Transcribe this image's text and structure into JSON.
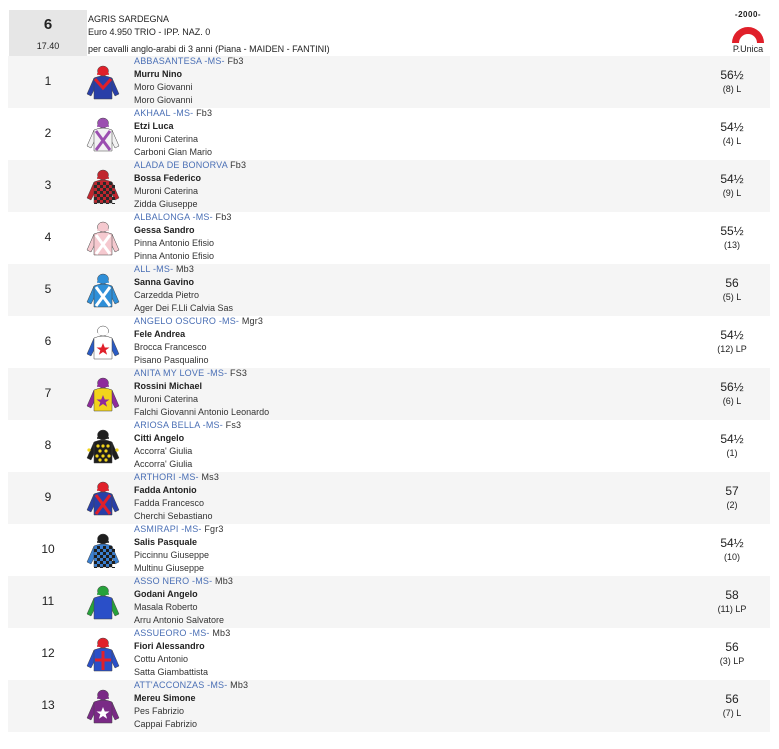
{
  "race": {
    "number": "6",
    "time": "17.40",
    "title": "AGRIS SARDEGNA",
    "prize": "Euro 4.950 TRIO - IPP. NAZ. 0",
    "description": "per cavalli anglo-arabi di 3 anni (Piana -  MAIDEN  - FANTINI)",
    "track_year": "2000",
    "track_label": "P.Unica"
  },
  "runners": [
    {
      "num": "1",
      "name": "ABBASANTESA -MS-",
      "extra": "Fb3",
      "jockey": "Murru Nino",
      "owner": "Moro Giovanni",
      "trainer": "Moro Giovanni",
      "weight": "56½",
      "post": "(8) L",
      "silk": {
        "body": "#283fa8",
        "sleeve": "#283fa8",
        "cap": "#e0202a",
        "pattern": "chevron",
        "pcolor": "#e0202a"
      }
    },
    {
      "num": "2",
      "name": "AKHAAL -MS-",
      "extra": "Fb3",
      "jockey": "Etzi Luca",
      "owner": "Muroni Caterina",
      "trainer": "Carboni Gian Mario",
      "weight": "54½",
      "post": "(4) L",
      "silk": {
        "body": "#f2f2f2",
        "sleeve": "#f2f2f2",
        "cap": "#9b4fb0",
        "pattern": "cross",
        "pcolor": "#9b4fb0"
      }
    },
    {
      "num": "3",
      "name": "ALADA DE BONORVA",
      "extra": "Fb3",
      "jockey": "Bossa Federico",
      "owner": "Muroni Caterina",
      "trainer": "Zidda Giuseppe",
      "weight": "54½",
      "post": "(9) L",
      "silk": {
        "body": "#c0262e",
        "sleeve": "#c0262e",
        "cap": "#c0262e",
        "pattern": "check",
        "pcolor": "#2a2a2a"
      }
    },
    {
      "num": "4",
      "name": "ALBALONGA -MS-",
      "extra": "Fb3",
      "jockey": "Gessa Sandro",
      "owner": "Pinna Antonio Efisio",
      "trainer": "Pinna Antonio Efisio",
      "weight": "55½",
      "post": "(13)",
      "silk": {
        "body": "#f5c9cf",
        "sleeve": "#f5c9cf",
        "cap": "#f5c9cf",
        "pattern": "cross",
        "pcolor": "#ffffff"
      }
    },
    {
      "num": "5",
      "name": "ALL -MS-",
      "extra": "Mb3",
      "jockey": "Sanna Gavino",
      "owner": "Carzedda Pietro",
      "trainer": "Ager Dei F.Lli Calvia Sas",
      "weight": "56",
      "post": "(5) L",
      "silk": {
        "body": "#2f8fd8",
        "sleeve": "#2f8fd8",
        "cap": "#2f8fd8",
        "pattern": "cross",
        "pcolor": "#ffffff"
      }
    },
    {
      "num": "6",
      "name": "ANGELO OSCURO -MS-",
      "extra": "Mgr3",
      "jockey": "Fele Andrea",
      "owner": "Brocca Francesco",
      "trainer": "Pisano Pasqualino",
      "weight": "54½",
      "post": "(12) LP",
      "silk": {
        "body": "#ffffff",
        "sleeve": "#2a5bc4",
        "cap": "#ffffff",
        "pattern": "star",
        "pcolor": "#e0202a"
      }
    },
    {
      "num": "7",
      "name": "ANITA MY LOVE -MS-",
      "extra": "FS3",
      "jockey": "Rossini Michael",
      "owner": "Muroni Caterina",
      "trainer": "Falchi Giovanni Antonio Leonardo",
      "weight": "56½",
      "post": "(6) L",
      "silk": {
        "body": "#f2d41c",
        "sleeve": "#8e2b9c",
        "cap": "#8e2b9c",
        "pattern": "star",
        "pcolor": "#8e2b9c"
      }
    },
    {
      "num": "8",
      "name": "ARIOSA BELLA -MS-",
      "extra": "Fs3",
      "jockey": "Citti Angelo",
      "owner": "Accorra' Giulia",
      "trainer": "Accorra' Giulia",
      "weight": "54½",
      "post": "(1)",
      "silk": {
        "body": "#1e1e1e",
        "sleeve": "#1e1e1e",
        "cap": "#1e1e1e",
        "pattern": "spots",
        "pcolor": "#f2d41c"
      }
    },
    {
      "num": "9",
      "name": "ARTHORI -MS-",
      "extra": "Ms3",
      "jockey": "Fadda Antonio",
      "owner": "Fadda Francesco",
      "trainer": "Cherchi Sebastiano",
      "weight": "57",
      "post": "(2)",
      "silk": {
        "body": "#283fa8",
        "sleeve": "#283fa8",
        "cap": "#e0202a",
        "pattern": "cross",
        "pcolor": "#e0202a"
      }
    },
    {
      "num": "10",
      "name": "ASMIRAPI -MS-",
      "extra": "Fgr3",
      "jockey": "Salis Pasquale",
      "owner": "Piccinnu Giuseppe",
      "trainer": "Multinu Giuseppe",
      "weight": "54½",
      "post": "(10)",
      "silk": {
        "body": "#3a7fd0",
        "sleeve": "#3a7fd0",
        "cap": "#1e1e1e",
        "pattern": "check",
        "pcolor": "#1e1e1e"
      }
    },
    {
      "num": "11",
      "name": "ASSO NERO -MS-",
      "extra": "Mb3",
      "jockey": "Godani Angelo",
      "owner": "Masala Roberto",
      "trainer": "Arru Antonio Salvatore",
      "weight": "58",
      "post": "(11) LP",
      "silk": {
        "body": "#2a4fc8",
        "sleeve": "#27a23b",
        "cap": "#27a23b",
        "pattern": "plain",
        "pcolor": "#27a23b"
      }
    },
    {
      "num": "12",
      "name": "ASSUEORO -MS-",
      "extra": "Mb3",
      "jockey": "Fiori Alessandro",
      "owner": "Cottu Antonio",
      "trainer": "Satta Giambattista",
      "weight": "56",
      "post": "(3) LP",
      "silk": {
        "body": "#2a4fc8",
        "sleeve": "#2a4fc8",
        "cap": "#e0202a",
        "pattern": "plus",
        "pcolor": "#e0202a"
      }
    },
    {
      "num": "13",
      "name": "ATT'ACCONZAS -MS-",
      "extra": "Mb3",
      "jockey": "Mereu Simone",
      "owner": "Pes Fabrizio",
      "trainer": "Cappai Fabrizio",
      "weight": "56",
      "post": "(7) L",
      "silk": {
        "body": "#7a2a86",
        "sleeve": "#7a2a86",
        "cap": "#7a2a86",
        "pattern": "star",
        "pcolor": "#ffffff"
      }
    }
  ]
}
